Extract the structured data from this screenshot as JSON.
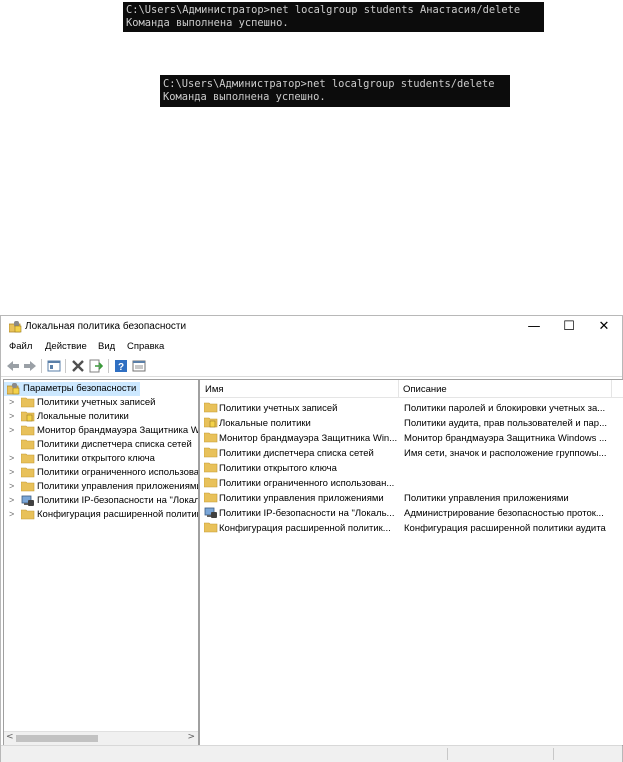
{
  "console1": {
    "line1": "C:\\Users\\Администратор>net localgroup students Анастасия/delete",
    "line2": "Команда выполнена успешно."
  },
  "console2": {
    "line1": "C:\\Users\\Администратор>net localgroup students/delete",
    "line2": "Команда выполнена успешно."
  },
  "window": {
    "title": "Локальная политика безопасности",
    "minimize": "—",
    "maximize": "☐",
    "close": "✕"
  },
  "menu": [
    "Файл",
    "Действие",
    "Вид",
    "Справка"
  ],
  "toolbar_icons": [
    "back-icon",
    "forward-icon",
    "show-hide-tree-icon",
    "delete-icon",
    "export-list-icon",
    "help-icon",
    "properties-icon"
  ],
  "tree": {
    "root": "Параметры безопасности",
    "items": [
      "Политики учетных записей",
      "Локальные политики",
      "Монитор брандмауэра Защитника Windows",
      "Политики диспетчера списка сетей",
      "Политики открытого ключа",
      "Политики ограниченного использования программ",
      "Политики управления приложениями",
      "Политики IP-безопасности на \"Локальный компьютер\"",
      "Конфигурация расширенной политики аудита"
    ]
  },
  "list": {
    "headers": {
      "name": "Имя",
      "description": "Описание"
    },
    "rows": [
      {
        "name": "Политики учетных записей",
        "description": "Политики паролей и блокировки учетных за..."
      },
      {
        "name": "Локальные политики",
        "description": "Политики аудита, прав пользователей и пар..."
      },
      {
        "name": "Монитор брандмауэра Защитника Win...",
        "description": "Монитор брандмауэра Защитника Windows ..."
      },
      {
        "name": "Политики диспетчера списка сетей",
        "description": "Имя сети, значок и расположение группowы..."
      },
      {
        "name": "Политики открытого ключа",
        "description": ""
      },
      {
        "name": "Политики ограниченного использован...",
        "description": ""
      },
      {
        "name": "Политики управления приложениями",
        "description": "Политики управления приложениями"
      },
      {
        "name": "Политики IP-безопасности на \"Локаль...",
        "description": "Администрирование безопасностью проток..."
      },
      {
        "name": "Конфигурация расширенной политик...",
        "description": "Конфигурация расширенной политики аудита"
      }
    ]
  },
  "colors": {
    "console_bg": "#0c0c0c",
    "console_text": "#cccccc",
    "selection": "#cce8ff",
    "folder": "#e8c15a"
  }
}
